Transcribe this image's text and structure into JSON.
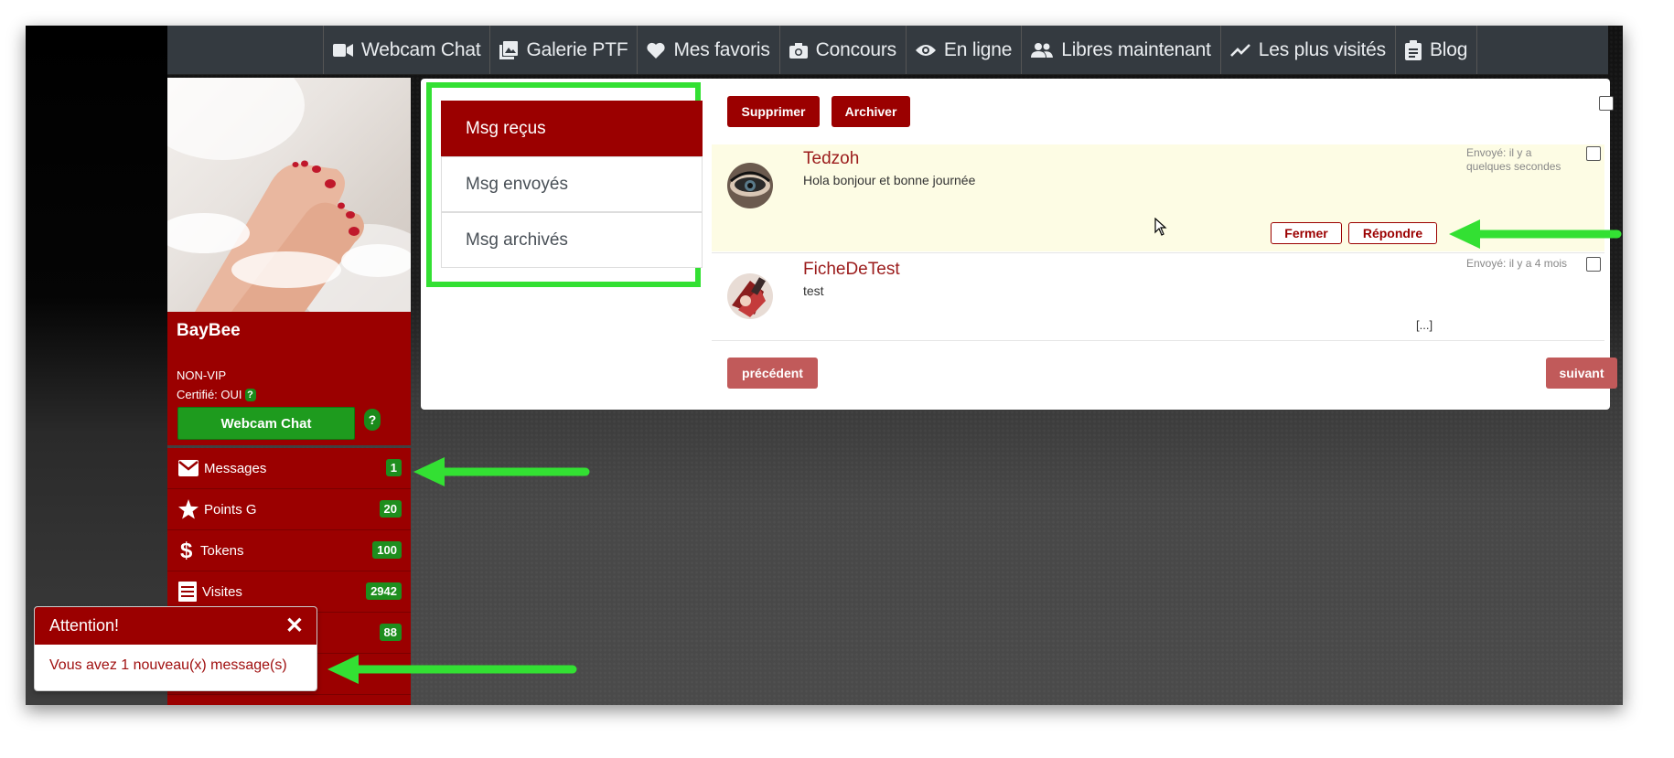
{
  "navbar": {
    "items": [
      {
        "label": "Webcam Chat",
        "icon": "video-camera-icon"
      },
      {
        "label": "Galerie PTF",
        "icon": "photo-gallery-icon"
      },
      {
        "label": "Mes favoris",
        "icon": "heart-icon"
      },
      {
        "label": "Concours",
        "icon": "camera-icon"
      },
      {
        "label": "En ligne",
        "icon": "eye-icon"
      },
      {
        "label": "Libres maintenant",
        "icon": "people-icon"
      },
      {
        "label": "Les plus visités",
        "icon": "trending-icon"
      },
      {
        "label": "Blog",
        "icon": "clipboard-icon"
      }
    ]
  },
  "profile": {
    "username": "BayBee",
    "vip_status": "NON-VIP",
    "certified": "Certifié: OUI",
    "help": "?",
    "webcam_button": "Webcam Chat"
  },
  "sidebar": {
    "items": [
      {
        "label": "Messages",
        "count": "1",
        "icon": "envelope-icon"
      },
      {
        "label": "Points G",
        "count": "20",
        "icon": "star-icon"
      },
      {
        "label": "Tokens",
        "count": "100",
        "icon": "dollar-icon"
      },
      {
        "label": "Visites",
        "count": "2942",
        "icon": "list-icon"
      },
      {
        "label": "",
        "count": "88",
        "icon": ""
      }
    ]
  },
  "folders": {
    "received": "Msg reçus",
    "sent": "Msg envoyés",
    "archived": "Msg archivés"
  },
  "toolbar": {
    "delete": "Supprimer",
    "archive": "Archiver"
  },
  "messages": [
    {
      "sender": "Tedzoh",
      "preview": "Hola bonjour et bonne journée",
      "sent": "Envoyé: il y a quelques secondes",
      "close": "Fermer",
      "reply": "Répondre"
    },
    {
      "sender": "FicheDeTest",
      "preview": "test",
      "sent": "Envoyé: il y a 4 mois",
      "more": "[...]"
    }
  ],
  "pagination": {
    "prev": "précédent",
    "next": "suivant"
  },
  "toast": {
    "title": "Attention!",
    "close": "✕",
    "body": "Vous avez 1 nouveau(x) message(s)"
  },
  "colors": {
    "brand_red": "#9b0000",
    "badge_green": "#1e8e1e",
    "annotation_green": "#33e033",
    "navbar": "#343a40"
  }
}
